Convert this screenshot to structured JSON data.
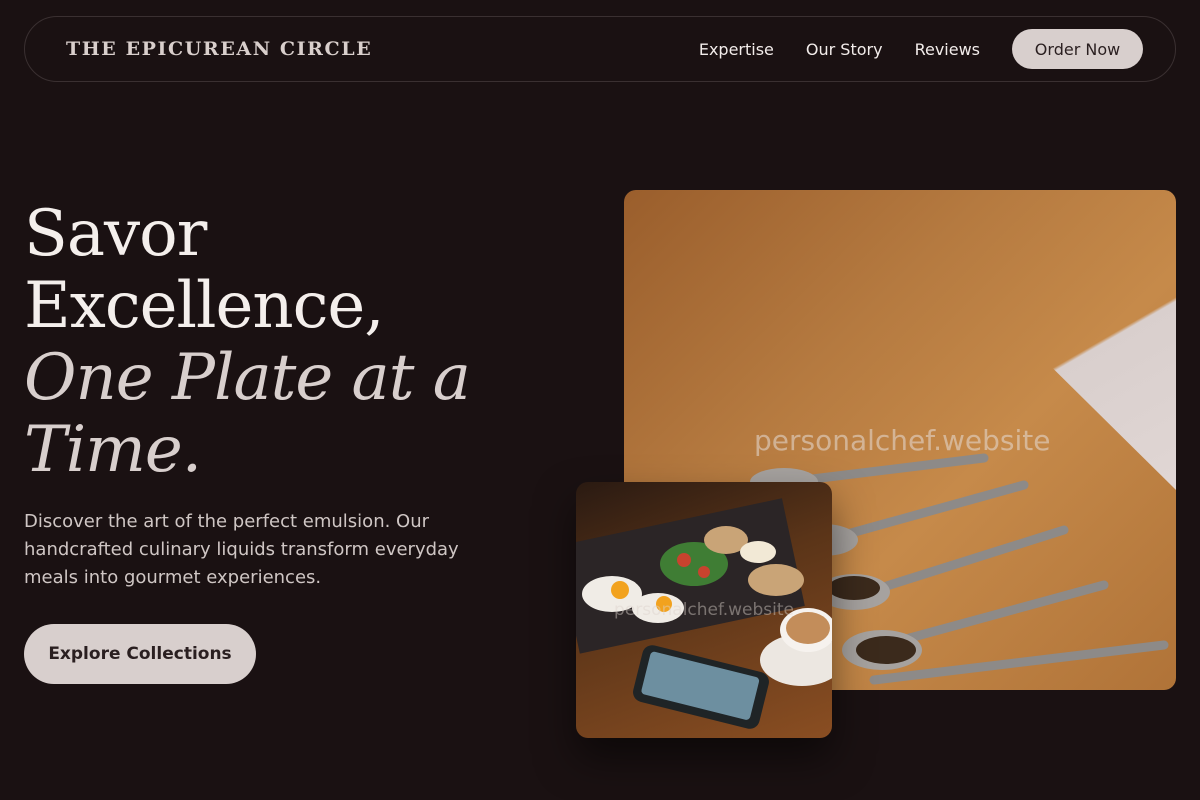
{
  "brand": "THE EPICUREAN CIRCLE",
  "nav": {
    "links": [
      "Expertise",
      "Our Story",
      "Reviews"
    ],
    "cta": "Order Now"
  },
  "hero": {
    "headline_line1": "Savor",
    "headline_line2": "Excellence,",
    "headline_accent": "One Plate at a Time.",
    "lede": "Discover the art of the perfect emulsion. Our handcrafted culinary liquids transform everyday meals into gourmet experiences.",
    "cta": "Explore Collections"
  },
  "images": {
    "main_watermark": "personalchef.website",
    "inset_watermark": "personalchef.website"
  },
  "colors": {
    "background": "#1a1112",
    "button": "#d8cfcd",
    "accent_text": "#d8cfcd"
  }
}
